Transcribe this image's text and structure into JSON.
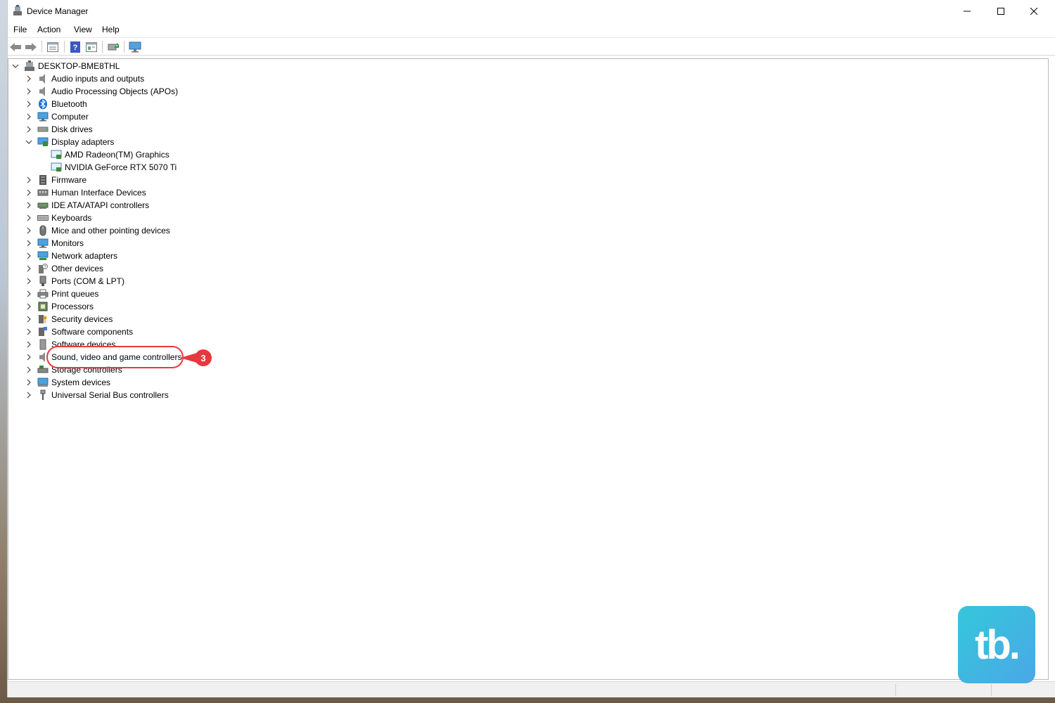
{
  "window": {
    "title": "Device Manager"
  },
  "menu": [
    "File",
    "Action",
    "View",
    "Help"
  ],
  "toolbar": {
    "buttons": [
      "back-icon",
      "forward-icon",
      "properties-icon",
      "help-icon",
      "show-hidden-icon",
      "update-driver-icon",
      "scan-hardware-icon"
    ]
  },
  "tree": {
    "root": "DESKTOP-BME8THL",
    "items": [
      {
        "label": "Audio inputs and outputs",
        "icon": "speaker-icon",
        "expanded": false
      },
      {
        "label": "Audio Processing Objects (APOs)",
        "icon": "speaker-icon",
        "expanded": false
      },
      {
        "label": "Bluetooth",
        "icon": "bluetooth-icon",
        "expanded": false
      },
      {
        "label": "Computer",
        "icon": "computer-icon",
        "expanded": false
      },
      {
        "label": "Disk drives",
        "icon": "disk-icon",
        "expanded": false
      },
      {
        "label": "Display adapters",
        "icon": "display-adapter-icon",
        "expanded": true
      },
      {
        "label": "AMD Radeon(TM) Graphics",
        "icon": "gpu-icon",
        "child": true
      },
      {
        "label": "NVIDIA GeForce RTX 5070 Ti",
        "icon": "gpu-icon",
        "child": true
      },
      {
        "label": "Firmware",
        "icon": "firmware-icon",
        "expanded": false
      },
      {
        "label": "Human Interface Devices",
        "icon": "hid-icon",
        "expanded": false
      },
      {
        "label": "IDE ATA/ATAPI controllers",
        "icon": "ide-icon",
        "expanded": false
      },
      {
        "label": "Keyboards",
        "icon": "keyboard-icon",
        "expanded": false
      },
      {
        "label": "Mice and other pointing devices",
        "icon": "mouse-icon",
        "expanded": false
      },
      {
        "label": "Monitors",
        "icon": "monitor-icon",
        "expanded": false
      },
      {
        "label": "Network adapters",
        "icon": "network-icon",
        "expanded": false
      },
      {
        "label": "Other devices",
        "icon": "unknown-device-icon",
        "expanded": false
      },
      {
        "label": "Ports (COM & LPT)",
        "icon": "port-icon",
        "expanded": false
      },
      {
        "label": "Print queues",
        "icon": "printer-icon",
        "expanded": false
      },
      {
        "label": "Processors",
        "icon": "processor-icon",
        "expanded": false
      },
      {
        "label": "Security devices",
        "icon": "security-icon",
        "expanded": false
      },
      {
        "label": "Software components",
        "icon": "software-component-icon",
        "expanded": false
      },
      {
        "label": "Software devices",
        "icon": "software-device-icon",
        "expanded": false
      },
      {
        "label": "Sound, video and game controllers",
        "icon": "speaker-icon",
        "expanded": false
      },
      {
        "label": "Storage controllers",
        "icon": "storage-icon",
        "expanded": false
      },
      {
        "label": "System devices",
        "icon": "system-icon",
        "expanded": false
      },
      {
        "label": "Universal Serial Bus controllers",
        "icon": "usb-icon",
        "expanded": false
      }
    ]
  },
  "annotation": {
    "step": "3",
    "color": "#e8383d"
  },
  "brand": {
    "logo_text": "tb."
  }
}
